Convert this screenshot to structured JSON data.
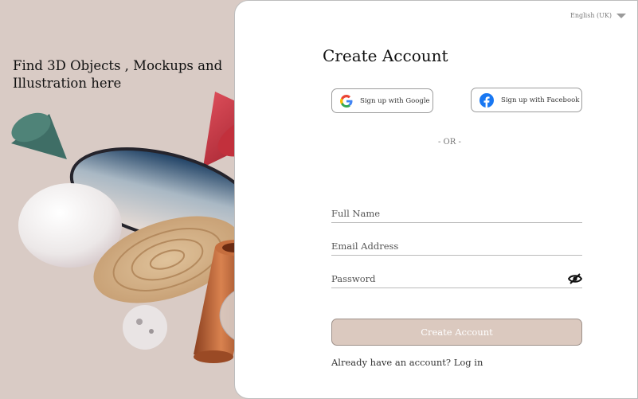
{
  "hero": {
    "headline": "Find 3D Objects , Mockups and Illustration here"
  },
  "language": {
    "selected": "English (UK)"
  },
  "form": {
    "title": "Create Account",
    "google_label": "Sign up with Google",
    "facebook_label": "Sign up with Facebook",
    "divider": "- OR -",
    "full_name_placeholder": "Full Name",
    "email_placeholder": "Email Address",
    "password_placeholder": "Password",
    "submit_label": "Create Account",
    "login_prompt": "Already have an account?",
    "login_link": "Log in"
  },
  "colors": {
    "background": "#d9cbc5",
    "button": "#dbc9bf",
    "facebook": "#1877f2"
  }
}
